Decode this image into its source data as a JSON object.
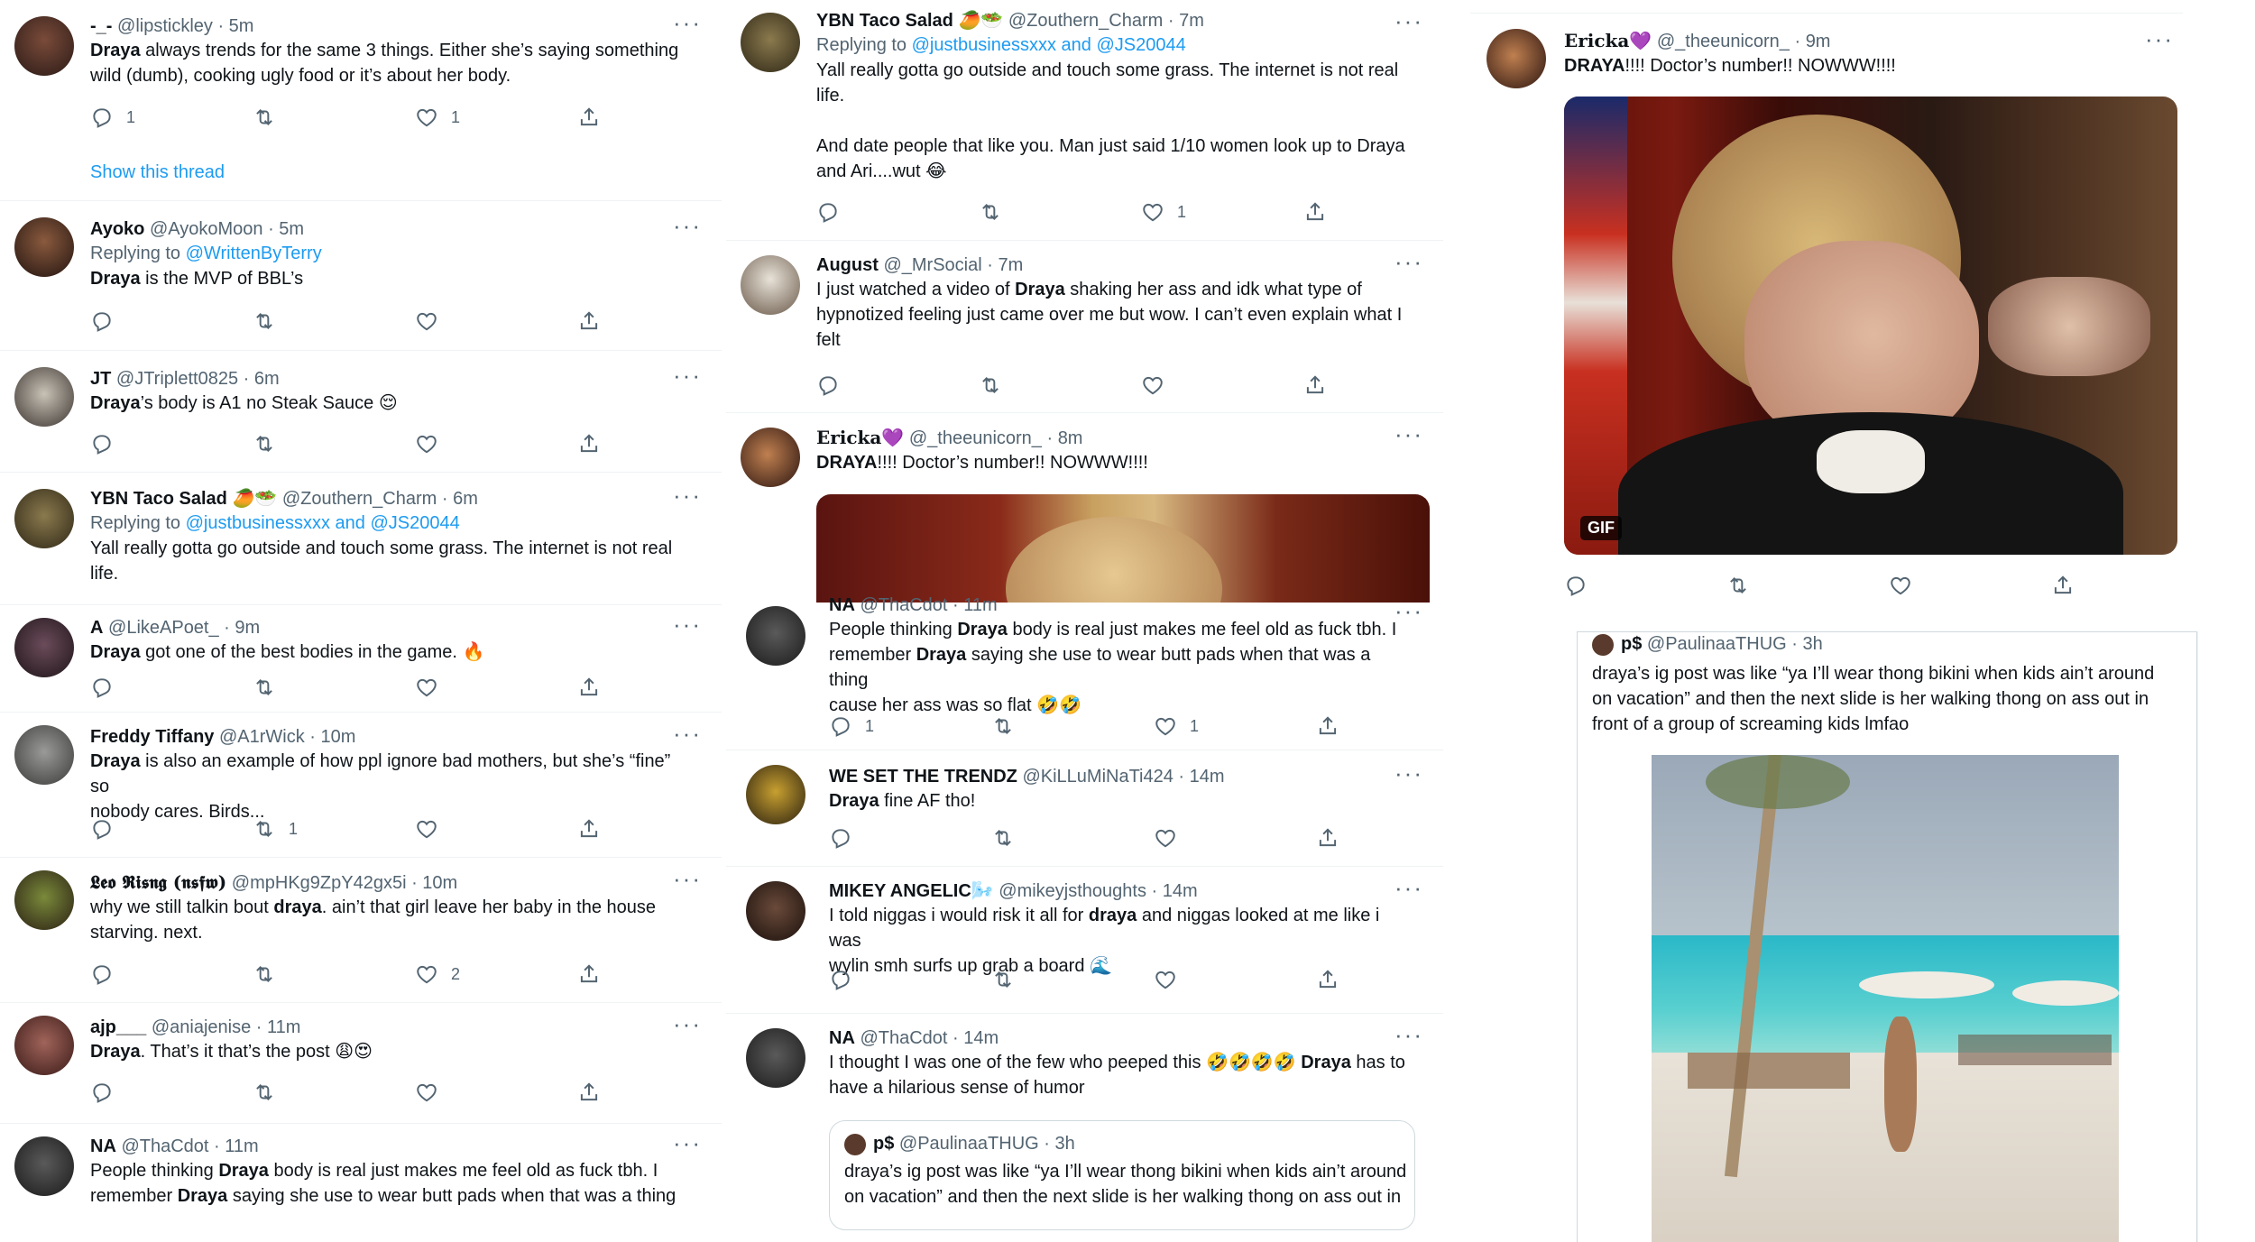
{
  "col1": {
    "tweets": [
      {
        "name": "-_-",
        "meta": "@lipstickley · 5m",
        "lines": [
          "<b>Draya</b> always trends for the same 3 things. Either she’s saying something",
          "wild (dumb), cooking ugly food or it’s about her body."
        ],
        "reply": "1",
        "retweet": "",
        "like": "1",
        "show_thread": "Show this thread"
      },
      {
        "name": "Ayoko",
        "meta": "@AyokoMoon · 5m",
        "replying_prefix": "Replying to ",
        "replying_to": "@WrittenByTerry",
        "lines": [
          "<b>Draya</b> is the MVP of BBL’s"
        ],
        "reply": "",
        "retweet": "",
        "like": ""
      },
      {
        "name": "JT",
        "meta": "@JTriplett0825 · 6m",
        "lines": [
          "<b>Draya</b>’s body is A1 no Steak Sauce 😌"
        ],
        "reply": "",
        "retweet": "",
        "like": ""
      },
      {
        "name": "YBN Taco Salad 🥭🥗",
        "meta": "@Zouthern_Charm · 6m",
        "replying_prefix": "Replying to ",
        "replying_to": "@justbusinessxxx and @JS20044",
        "lines": [
          "Yall really gotta go outside and touch some grass. The internet is not real",
          "life."
        ]
      },
      {
        "name": "A",
        "meta": "@LikeAPoet_ · 9m",
        "lines": [
          "<b>Draya</b> got one of the best bodies in the game. 🔥"
        ],
        "reply": "",
        "retweet": "",
        "like": ""
      },
      {
        "name": "Freddy Tiffany",
        "meta": "@A1rWick · 10m",
        "lines": [
          "<b>Draya</b> is also an example of how ppl ignore bad mothers, but she’s “fine” so",
          "nobody cares. Birds..."
        ],
        "reply": "",
        "retweet": "1",
        "like": ""
      },
      {
        "name": "𝕷𝖊𝖔 𝕽𝖎𝖘𝖓𝖌 (𝖓𝖘𝖋𝖜)",
        "meta": "@mpHKg9ZpY42gx5i · 10m",
        "lines": [
          "why we still talkin bout <b>draya</b>. ain’t that girl leave her baby in the house",
          "starving. next."
        ],
        "reply": "",
        "retweet": "",
        "like": "2"
      },
      {
        "name": "ajp___",
        "meta": "@aniajenise · 11m",
        "lines": [
          "<b>Draya</b>. That’s it that’s the post 😩😍"
        ],
        "reply": "",
        "retweet": "",
        "like": ""
      },
      {
        "name": "NA",
        "meta": "@ThaCdot · 11m",
        "lines": [
          "People thinking <b>Draya</b> body is real just makes me feel old as fuck tbh. I",
          "remember <b>Draya</b> saying she use to wear butt pads when that was a thing"
        ]
      }
    ]
  },
  "col2": {
    "tweets": [
      {
        "name": "YBN Taco Salad 🥭🥗",
        "meta": "@Zouthern_Charm · 7m",
        "replying_prefix": "Replying to ",
        "replying_to": "@justbusinessxxx and @JS20044",
        "lines": [
          "Yall really gotta go outside and touch some grass. The internet is not real",
          "life.",
          "",
          "And date people that like you. Man just said 1/10 women look up to Draya",
          "and Ari....wut 😂"
        ],
        "reply": "",
        "retweet": "",
        "like": "1"
      },
      {
        "name": "August",
        "meta": "@_MrSocial · 7m",
        "lines": [
          "I just watched a video of <b>Draya</b> shaking her ass and idk what type of",
          "hypnotized feeling just came over me but wow. I can’t even explain what I",
          "felt"
        ],
        "reply": "",
        "retweet": "",
        "like": ""
      },
      {
        "name": "Ericka💜",
        "meta": "@_theeunicorn_ · 8m",
        "lines": [
          "<b>DRAYA</b>!!!! Doctor’s number!! NOWWW!!!!"
        ]
      },
      {
        "name": "NA",
        "meta": "@ThaCdot · 11m",
        "lines": [
          "People thinking <b>Draya</b> body is real just makes me feel old as fuck tbh. I",
          "remember <b>Draya</b> saying she use to wear butt pads when that was a thing",
          "cause her ass was so flat 🤣🤣"
        ],
        "reply": "1",
        "retweet": "",
        "like": "1"
      },
      {
        "name": "WE SET THE TRENDZ",
        "meta": "@KiLLuMiNaTi424 · 14m",
        "lines": [
          "<b>Draya</b> fine AF tho!"
        ],
        "reply": "",
        "retweet": "",
        "like": ""
      },
      {
        "name": "MIKEY ANGELIC🌬️",
        "meta": "@mikeyjsthoughts · 14m",
        "lines": [
          "I told niggas i would risk it all for <b>draya</b> and niggas looked at me like i was",
          "wylin smh surfs up grab a board 🌊"
        ],
        "reply": "",
        "retweet": "",
        "like": ""
      },
      {
        "name": "NA",
        "meta": "@ThaCdot · 14m",
        "lines": [
          "I thought I was one of the few who peeped this 🤣🤣🤣🤣 <b>Draya</b> has to",
          "have a hilarious sense of humor"
        ],
        "quote": {
          "name": "p$",
          "meta": "@PaulinaaTHUG · 3h",
          "lines": [
            "draya’s ig post was like “ya I’ll wear thong bikini when kids ain’t around",
            "on vacation” and then the next slide is her walking thong on ass out in"
          ]
        }
      }
    ]
  },
  "col3": {
    "tweet": {
      "name": "Ericka💜",
      "meta": "@_theeunicorn_ · 9m",
      "lines": [
        "<b>DRAYA</b>!!!! Doctor’s number!! NOWWW!!!!"
      ],
      "gif_label": "GIF"
    },
    "quote": {
      "name": "p$",
      "meta": "@PaulinaaTHUG · 3h",
      "lines": [
        "draya’s ig post was like “ya I’ll wear thong bikini when kids ain’t around",
        "on vacation” and then the next slide is her walking thong on ass out in",
        "front of a group of screaming kids lmfao"
      ]
    }
  },
  "colors": {
    "text": "#0f1419",
    "secondary": "#536471",
    "link": "#1d9bf0",
    "divider": "#eff3f4"
  },
  "icons": [
    "reply-icon",
    "retweet-icon",
    "like-icon",
    "share-icon",
    "more-icon"
  ]
}
